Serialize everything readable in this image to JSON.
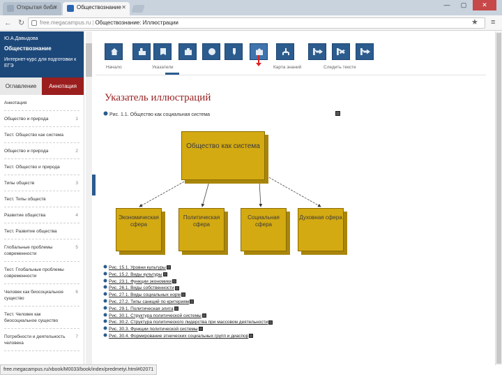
{
  "browser": {
    "tabs": [
      {
        "label": "Открытая библ"
      },
      {
        "label": "Обществознание"
      }
    ],
    "address": {
      "domain": "free.megacampus.ru",
      "title": "Обществознание: Иллюстрации"
    },
    "status_url": "free.megacampus.ru/xbook/M0033/book/index/predmetyi.html#02071"
  },
  "sidebar": {
    "author": "Ю.А.Давыдова",
    "subject": "Обществознание",
    "course": "Интернет-курс для подготовки к ЕГЭ",
    "tabs": {
      "toc": "Оглавление",
      "annotation": "Аннотация"
    },
    "items": [
      {
        "label": "Аннотация",
        "num": ""
      },
      {
        "label": "Общество и природа",
        "num": "1"
      },
      {
        "label": "Тест. Общество как система",
        "num": ""
      },
      {
        "label": "Общество и природа",
        "num": "2"
      },
      {
        "label": "Тест. Общество и природа",
        "num": ""
      },
      {
        "label": "Типы обществ",
        "num": "3"
      },
      {
        "label": "Тест. Типы обществ",
        "num": ""
      },
      {
        "label": "Развитие общества",
        "num": "4"
      },
      {
        "label": "Тест. Развитие общества",
        "num": ""
      },
      {
        "label": "Глобальные проблемы современности",
        "num": "5"
      },
      {
        "label": "Тест. Глобальные проблемы современности",
        "num": ""
      },
      {
        "label": "Человек как биосоциальное существо",
        "num": "6"
      },
      {
        "label": "Тест. Человек как биосоциальное существо",
        "num": ""
      },
      {
        "label": "Потребности и деятельность человека",
        "num": "7"
      }
    ]
  },
  "mainnav": {
    "labels": {
      "home": "Начало",
      "index": "Указатели",
      "map": "Карта знаний",
      "nav": "Следить тексте"
    }
  },
  "content": {
    "title": "Указатель иллюстраций",
    "first_figure": "Рис. 1.1. Общество как социальная система",
    "diagram": {
      "center": "Общество как система",
      "spheres": [
        {
          "label": "Экономическая сфера"
        },
        {
          "label": "Политическая сфера"
        },
        {
          "label": "Социальная сфера"
        },
        {
          "label": "Духовная сфера"
        }
      ]
    },
    "figures": [
      {
        "label": "Рис. 15.1. Уровни культуры"
      },
      {
        "label": "Рис. 15.2. Виды культуры"
      },
      {
        "label": "Рис. 23.1. Функции экономики"
      },
      {
        "label": "Рис. 26.1. Виды собственности"
      },
      {
        "label": "Рис. 27.1. Виды социальных норм"
      },
      {
        "label": "Рис. 27.2. Типы санкций по критериям"
      },
      {
        "label": "Рис. 29.1. Политическая элита"
      },
      {
        "label": "Рис. 30.1. Структура политической системы"
      },
      {
        "label": "Рис. 30.2. Структура политического лидерства при массовом деятельности"
      },
      {
        "label": "Рис. 30.3. Функции политической системы"
      },
      {
        "label": "Рис. 30.4. Формирование этнических социальных групп и диаспор"
      }
    ]
  },
  "colors": {
    "sidebar_header": "#1c4779",
    "annotation_tab": "#9a1e1e",
    "nav_button": "#2c5c8e",
    "box_fill": "#d4aa12",
    "title_red": "#9a1e1e"
  },
  "icons": [
    "home-icon",
    "users-icon",
    "book-icon",
    "briefcase-icon",
    "globe-icon",
    "pen-icon",
    "camera-icon",
    "tree-icon",
    "next-icon",
    "close-panel-icon",
    "forward-icon"
  ]
}
